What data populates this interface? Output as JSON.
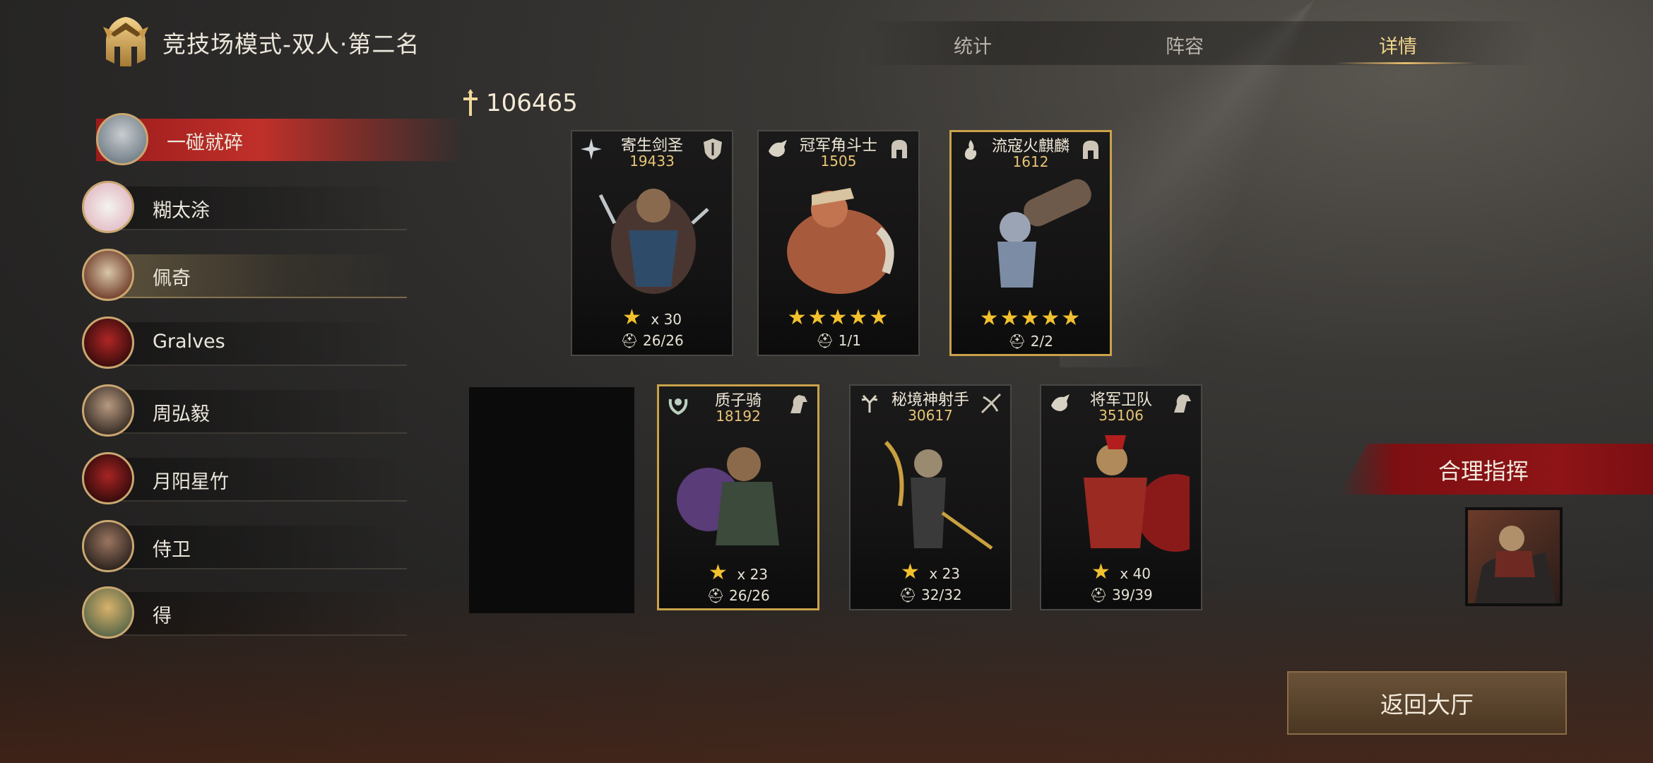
{
  "header": {
    "title": "竞技场模式-双人·第二名",
    "tabs": [
      {
        "label": "统计",
        "active": false
      },
      {
        "label": "阵容",
        "active": false
      },
      {
        "label": "详情",
        "active": true
      }
    ]
  },
  "team": {
    "total_power": "106465"
  },
  "players": [
    {
      "name": "一碰就碎",
      "highlight": "self"
    },
    {
      "name": "糊太涂",
      "highlight": "none"
    },
    {
      "name": "佩奇",
      "highlight": "ally"
    },
    {
      "name": "Gralves",
      "highlight": "none"
    },
    {
      "name": "周弘毅",
      "highlight": "none"
    },
    {
      "name": "月阳星竹",
      "highlight": "none"
    },
    {
      "name": "侍卫",
      "highlight": "none"
    },
    {
      "name": "得",
      "highlight": "none"
    }
  ],
  "heroes": [
    {
      "name": "寄生剑圣",
      "power": "19433",
      "stars_display": "★",
      "star_count": "x 30",
      "troops": "26/26",
      "border": "gray"
    },
    {
      "name": "冠军角斗士",
      "power": "1505",
      "stars_display": "★★★★★",
      "star_count": "",
      "troops": "1/1",
      "border": "gray"
    },
    {
      "name": "流寇火麒麟",
      "power": "1612",
      "stars_display": "★★★★★",
      "star_count": "",
      "troops": "2/2",
      "border": "gold"
    },
    {
      "name": "质子骑",
      "power": "18192",
      "stars_display": "★",
      "star_count": "x 23",
      "troops": "26/26",
      "border": "gold"
    },
    {
      "name": "秘境神射手",
      "power": "30617",
      "stars_display": "★",
      "star_count": "x 23",
      "troops": "32/32",
      "border": "gray"
    },
    {
      "name": "将军卫队",
      "power": "35106",
      "stars_display": "★",
      "star_count": "x 40",
      "troops": "39/39",
      "border": "gray"
    }
  ],
  "commander": {
    "label": "合理指挥"
  },
  "actions": {
    "return_label": "返回大厅"
  },
  "colors": {
    "accent_gold": "#e8be6e",
    "banner_red": "#8e1417",
    "star_yellow": "#f2c12e"
  }
}
